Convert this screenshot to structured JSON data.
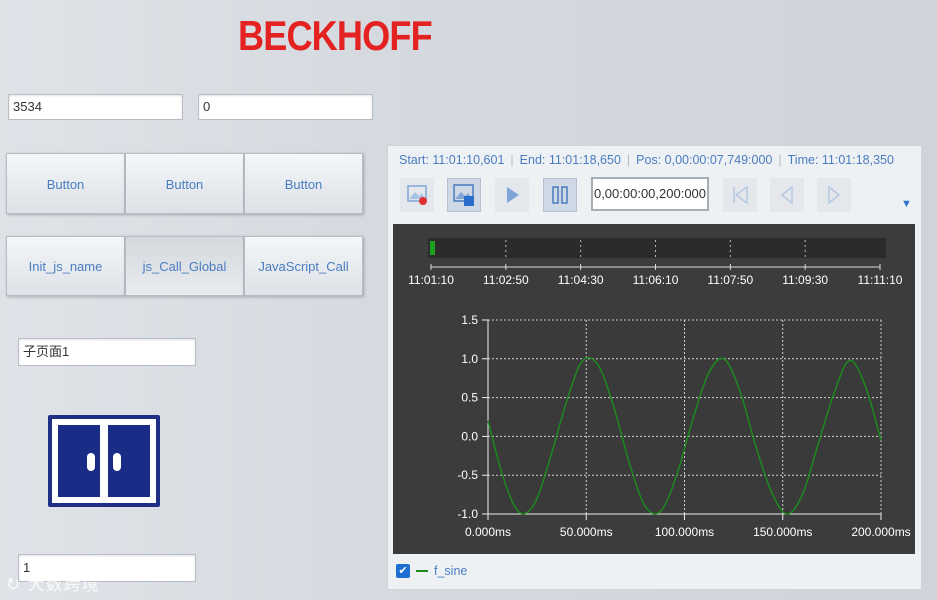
{
  "brand": {
    "logo_text": "BECKHOFF",
    "logo_color": "#e32221"
  },
  "inputs": {
    "value_a": "3534",
    "value_b": "0",
    "subpage": "子页面1",
    "bottom": "1"
  },
  "buttons_row1": [
    "Button",
    "Button",
    "Button"
  ],
  "buttons_row2": [
    "Init_js_name",
    "js_Call_Global",
    "JavaScript_Call"
  ],
  "trend": {
    "start": "Start: 11:01:10,601",
    "end": "End: 11:01:18,650",
    "pos": "Pos: 0,00:00:07,749:000",
    "time": "Time: 11:01:18,350",
    "position_value": "0,00:00:00,200:000",
    "overview_ticks": [
      "11:01:10",
      "11:02:50",
      "11:04:30",
      "11:06:10",
      "11:07:50",
      "11:09:30",
      "11:11:10"
    ],
    "legend_label": "f_sine",
    "legend_checked": true,
    "toolbar_icons": [
      "record-icon",
      "save-image-icon",
      "play-icon",
      "pause-icon",
      "skip-start-icon",
      "step-back-icon",
      "step-forward-icon"
    ]
  },
  "chart_data": {
    "type": "line",
    "title": "",
    "xlabel": "",
    "ylabel": "",
    "xlim": [
      0,
      200
    ],
    "ylim": [
      -1.0,
      1.5
    ],
    "x_ticks": [
      "0.000ms",
      "50.000ms",
      "100.000ms",
      "150.000ms",
      "200.000ms"
    ],
    "y_ticks": [
      "1.5",
      "1.0",
      "0.5",
      "0.0",
      "-0.5",
      "-1.0"
    ],
    "grid": true,
    "series": [
      {
        "name": "f_sine",
        "color": "#1d8a1d",
        "x": [
          0,
          8,
          16,
          24,
          32,
          40,
          48,
          56,
          64,
          72,
          80,
          88,
          96,
          104,
          112,
          120,
          128,
          136,
          144,
          152,
          160,
          168,
          176,
          184,
          192,
          200
        ],
        "y": [
          0.2,
          -0.55,
          -0.98,
          -0.85,
          -0.25,
          0.45,
          0.97,
          0.92,
          0.38,
          -0.35,
          -0.9,
          -0.96,
          -0.5,
          0.2,
          0.8,
          1.0,
          0.6,
          -0.1,
          -0.7,
          -1.0,
          -0.75,
          -0.1,
          0.55,
          0.98,
          0.65,
          -0.05
        ]
      }
    ]
  },
  "watermark": "大数跨境"
}
